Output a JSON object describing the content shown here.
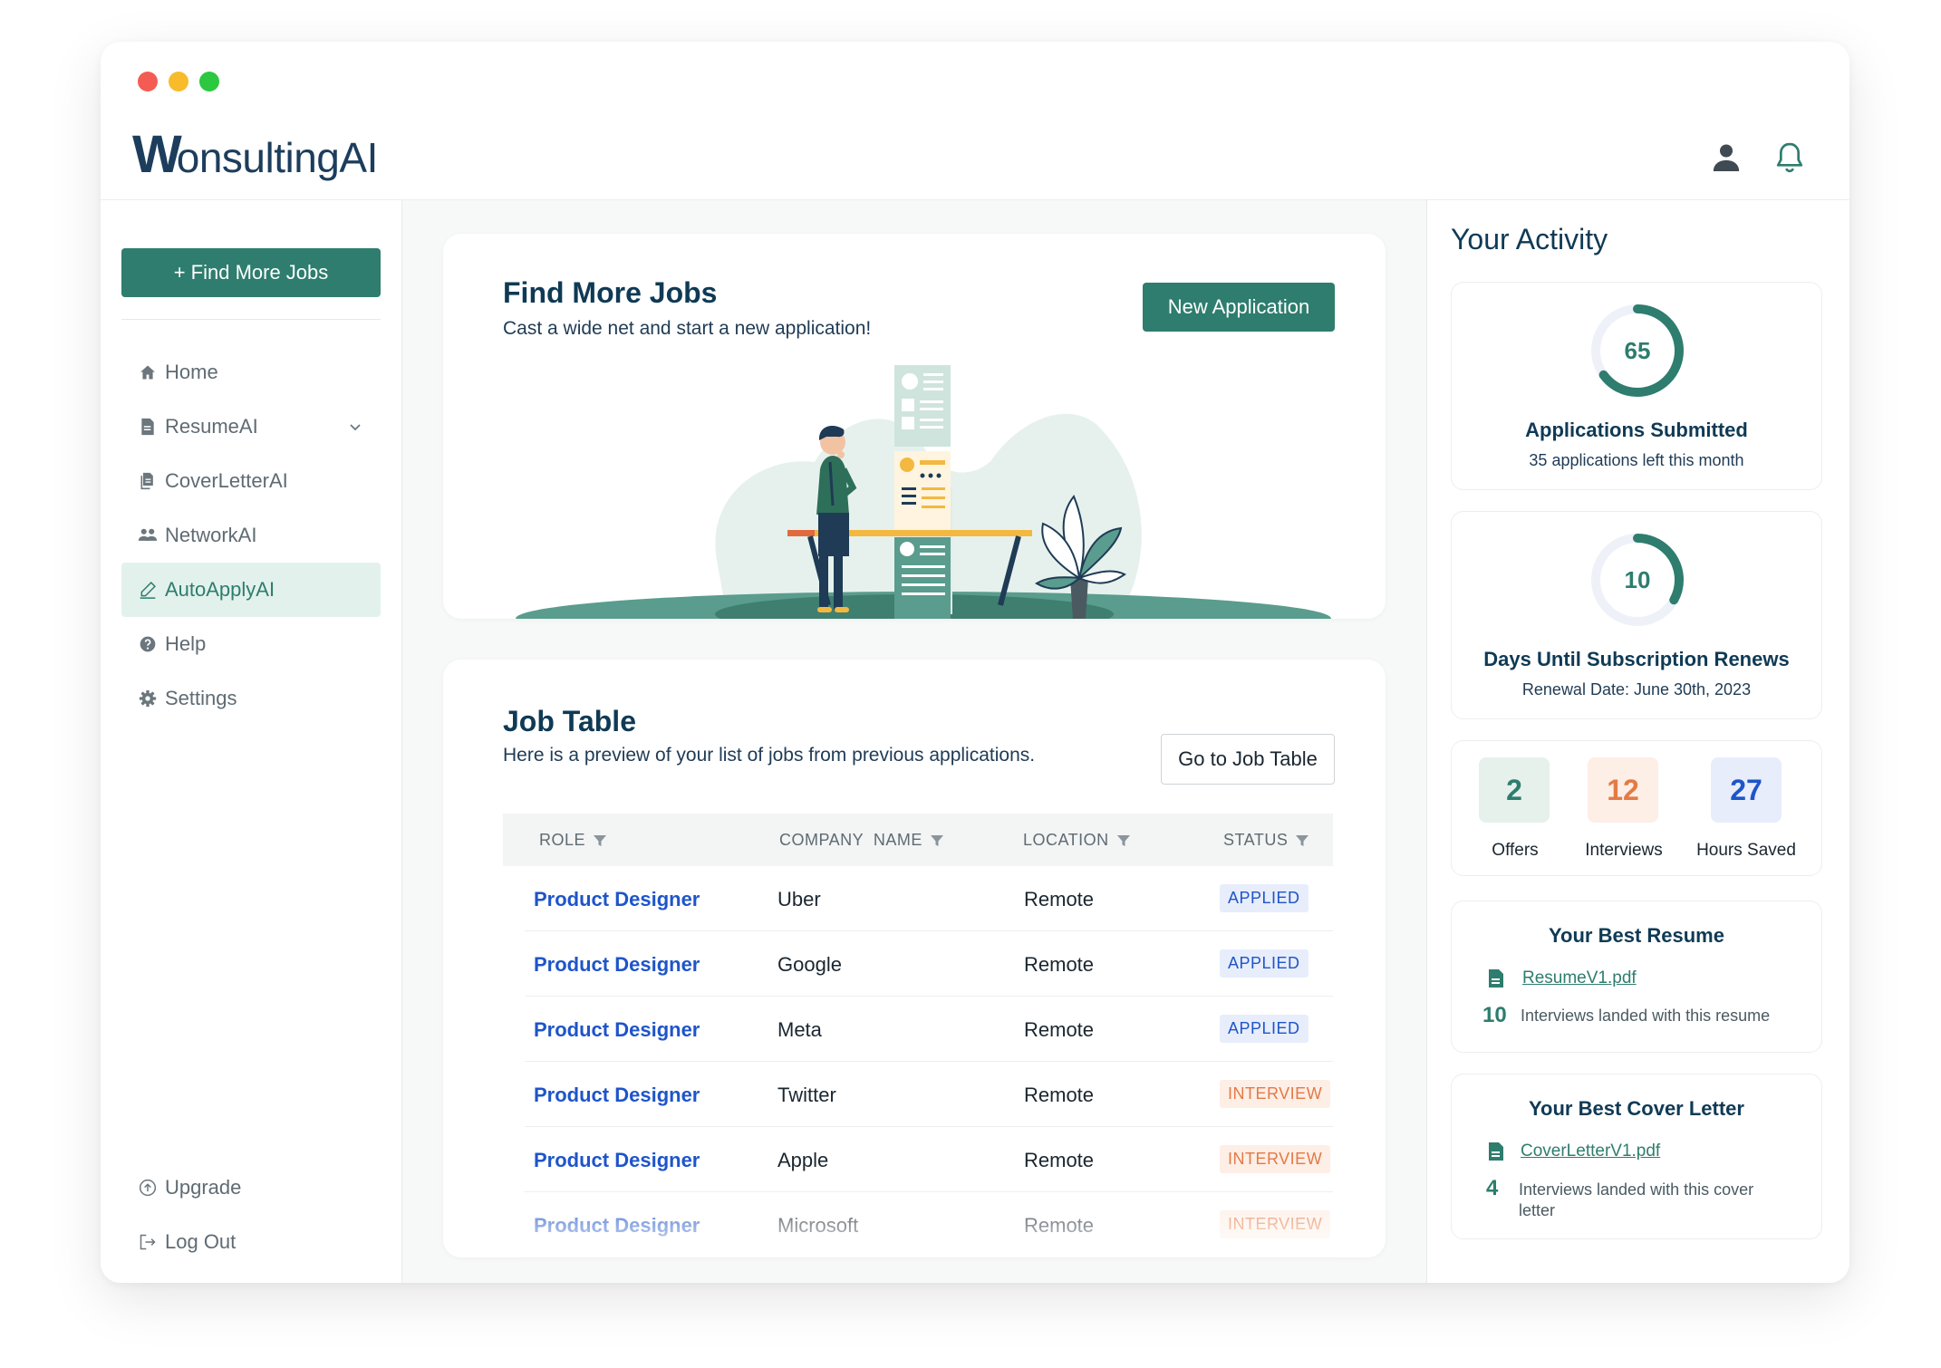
{
  "colors": {
    "brand": "#2e7d6e",
    "navy": "#0f3a55",
    "link_blue": "#1e55c9",
    "interview_orange": "#e37a45",
    "dot_red": "#f45b52",
    "dot_yellow": "#f8bb2b",
    "dot_green": "#2bc840"
  },
  "app": {
    "logo": "WonsultingAI",
    "logo_w": "W",
    "logo_rest": "onsultingAI"
  },
  "header": {
    "profile_icon": "user-icon",
    "notification_icon": "bell-icon"
  },
  "sidebar": {
    "cta_label": "+ Find More Jobs",
    "items": [
      {
        "label": "Home",
        "icon": "home-icon"
      },
      {
        "label": "ResumeAI",
        "icon": "document-icon"
      },
      {
        "label": "CoverLetterAI",
        "icon": "documents-icon"
      },
      {
        "label": "NetworkAI",
        "icon": "people-icon"
      },
      {
        "label": "AutoApplyAI",
        "icon": "pen-icon"
      },
      {
        "label": "Help",
        "icon": "help-icon"
      },
      {
        "label": "Settings",
        "icon": "gear-icon"
      }
    ],
    "bottom": [
      {
        "label": "Upgrade",
        "icon": "upgrade-icon"
      },
      {
        "label": "Log Out",
        "icon": "logout-icon"
      }
    ]
  },
  "find_jobs": {
    "title": "Find More Jobs",
    "subtitle": "Cast a wide net and start a new application!",
    "button": "New Application"
  },
  "job_table": {
    "title": "Job Table",
    "subtitle": "Here is a preview of your list of jobs from previous applications.",
    "button": "Go to Job Table",
    "headers": [
      "ROLE",
      "COMPANY  NAME",
      "LOCATION",
      "STATUS"
    ],
    "rows": [
      {
        "role": "Product Designer",
        "company": "Uber",
        "location": "Remote",
        "status": "APPLIED"
      },
      {
        "role": "Product Designer",
        "company": "Google",
        "location": "Remote",
        "status": "APPLIED"
      },
      {
        "role": "Product Designer",
        "company": "Meta",
        "location": "Remote",
        "status": "APPLIED"
      },
      {
        "role": "Product Designer",
        "company": "Twitter",
        "location": "Remote",
        "status": "INTERVIEW"
      },
      {
        "role": "Product Designer",
        "company": "Apple",
        "location": "Remote",
        "status": "INTERVIEW"
      },
      {
        "role": "Product Designer",
        "company": "Microsoft",
        "location": "Remote",
        "status": "INTERVIEW"
      }
    ]
  },
  "activity": {
    "title": "Your Activity",
    "applications": {
      "value": "65",
      "fraction": 0.65,
      "label": "Applications Submitted",
      "sub": "35 applications left this month"
    },
    "subscription": {
      "value": "10",
      "fraction": 0.33,
      "label": "Days Until Subscription Renews",
      "sub": "Renewal Date: June 30th, 2023"
    },
    "stats": [
      {
        "value": "2",
        "label": "Offers"
      },
      {
        "value": "12",
        "label": "Interviews"
      },
      {
        "value": "27",
        "label": "Hours Saved"
      }
    ],
    "best_resume": {
      "title": "Your Best Resume",
      "file": "ResumeV1.pdf",
      "count": "10",
      "text": "Interviews landed with this resume"
    },
    "best_cover": {
      "title": "Your Best Cover Letter",
      "file": "CoverLetterV1.pdf",
      "count": "4",
      "text": "Interviews landed with this cover letter"
    }
  }
}
